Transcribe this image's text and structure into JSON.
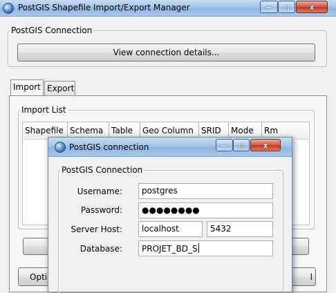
{
  "main_window": {
    "title": "PostGIS Shapefile Import/Export Manager",
    "connection_group": {
      "legend": "PostGIS Connection",
      "view_details_label": "View connection details..."
    },
    "tabs": [
      {
        "label": "Import"
      },
      {
        "label": "Export"
      }
    ],
    "import_list": {
      "legend": "Import List",
      "columns": [
        "Shapefile",
        "Schema",
        "Table",
        "Geo Column",
        "SRID",
        "Mode",
        "Rm"
      ]
    },
    "options_label_partial": "Opti",
    "right_button_partial": "l"
  },
  "dialog": {
    "title": "PostGIS connection",
    "group_legend": "PostGIS Connection",
    "username_label": "Username:",
    "username_value": "postgres",
    "password_label": "Password:",
    "password_value": "●●●●●●●●",
    "host_label": "Server Host:",
    "host_value": "localhost",
    "port_value": "5432",
    "database_label": "Database:",
    "database_value": "PROJET_BD_S"
  },
  "window_controls": {
    "minimize": "–",
    "maximize": "□",
    "close": "x"
  },
  "colors": {
    "titlebar": "#a4c5ea",
    "close_button": "#c23a20",
    "window_bg": "#f0f0f0"
  }
}
